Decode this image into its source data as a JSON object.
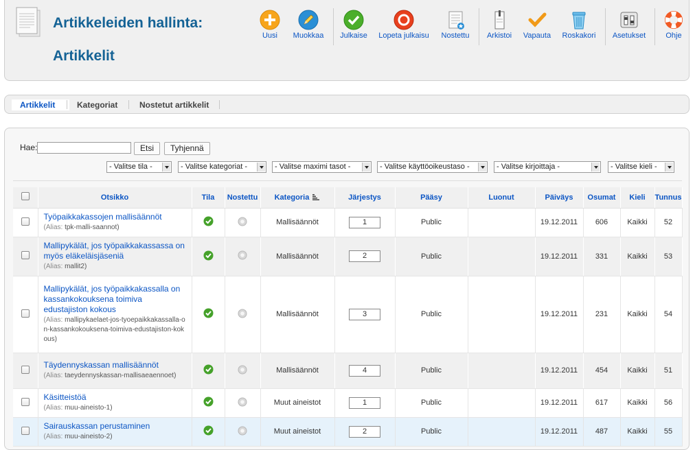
{
  "header": {
    "title": "Artikkeleiden hallinta:",
    "subtitle": "Artikkelit",
    "toolbar": [
      {
        "label": "Uusi",
        "icon": "new-icon"
      },
      {
        "label": "Muokkaa",
        "icon": "edit-icon"
      },
      {
        "label": "Julkaise",
        "icon": "publish-icon"
      },
      {
        "label": "Lopeta julkaisu",
        "icon": "unpublish-icon"
      },
      {
        "label": "Nostettu",
        "icon": "featured-icon"
      },
      {
        "label": "Arkistoi",
        "icon": "archive-icon"
      },
      {
        "label": "Vapauta",
        "icon": "checkin-icon"
      },
      {
        "label": "Roskakori",
        "icon": "trash-icon"
      },
      {
        "label": "Asetukset",
        "icon": "options-icon"
      },
      {
        "label": "Ohje",
        "icon": "help-icon"
      }
    ]
  },
  "submenu": {
    "items": [
      "Artikkelit",
      "Kategoriat",
      "Nostetut artikkelit"
    ]
  },
  "search": {
    "label": "Hae:",
    "value": "",
    "search_button": "Etsi",
    "clear_button": "Tyhjennä"
  },
  "filters": [
    "- Valitse tila -",
    "- Valitse kategoriat -",
    "- Valitse maximi tasot -",
    "- Valitse käyttöoikeustaso -",
    "- Valitse kirjoittaja -",
    "- Valitse kieli -"
  ],
  "table": {
    "columns": [
      "Otsikko",
      "Tila",
      "Nostettu",
      "Kategoria",
      "Järjestys",
      "Pääsy",
      "Luonut",
      "Päiväys",
      "Osumat",
      "Kieli",
      "Tunnus"
    ],
    "alias_prefix": "(Alias:",
    "rows": [
      {
        "title": "Työpaikkakassojen mallisäännöt",
        "alias": "tpk-malli-saannot)",
        "category": "Mallisäännöt",
        "order": "1",
        "access": "Public",
        "author": "",
        "date": "19.12.2011",
        "hits": "606",
        "language": "Kaikki",
        "id": "52"
      },
      {
        "title": "Mallipykälät, jos työpaikkakassassa on myös eläkeläisjäseniä",
        "alias": "mallit2)",
        "category": "Mallisäännöt",
        "order": "2",
        "access": "Public",
        "author": "",
        "date": "19.12.2011",
        "hits": "331",
        "language": "Kaikki",
        "id": "53"
      },
      {
        "title": "Mallipykälät, jos työpaikkakassalla on kassankokouksena toimiva edustajiston kokous",
        "alias": "mallipykaelaet-jos-tyoepaikkakassalla-on-kassankokouksena-toimiva-edustajiston-kokous)",
        "category": "Mallisäännöt",
        "order": "3",
        "access": "Public",
        "author": "",
        "date": "19.12.2011",
        "hits": "231",
        "language": "Kaikki",
        "id": "54"
      },
      {
        "title": "Täydennyskassan mallisäännöt",
        "alias": "taeydennyskassan-mallisaeaennoet)",
        "category": "Mallisäännöt",
        "order": "4",
        "access": "Public",
        "author": "",
        "date": "19.12.2011",
        "hits": "454",
        "language": "Kaikki",
        "id": "51"
      },
      {
        "title": "Käsitteistöä",
        "alias": "muu-aineisto-1)",
        "category": "Muut aineistot",
        "order": "1",
        "access": "Public",
        "author": "",
        "date": "19.12.2011",
        "hits": "617",
        "language": "Kaikki",
        "id": "56"
      },
      {
        "title": "Sairauskassan perustaminen",
        "alias": "muu-aineisto-2)",
        "category": "Muut aineistot",
        "order": "2",
        "access": "Public",
        "author": "",
        "date": "19.12.2011",
        "hits": "487",
        "language": "Kaikki",
        "id": "55"
      }
    ]
  }
}
